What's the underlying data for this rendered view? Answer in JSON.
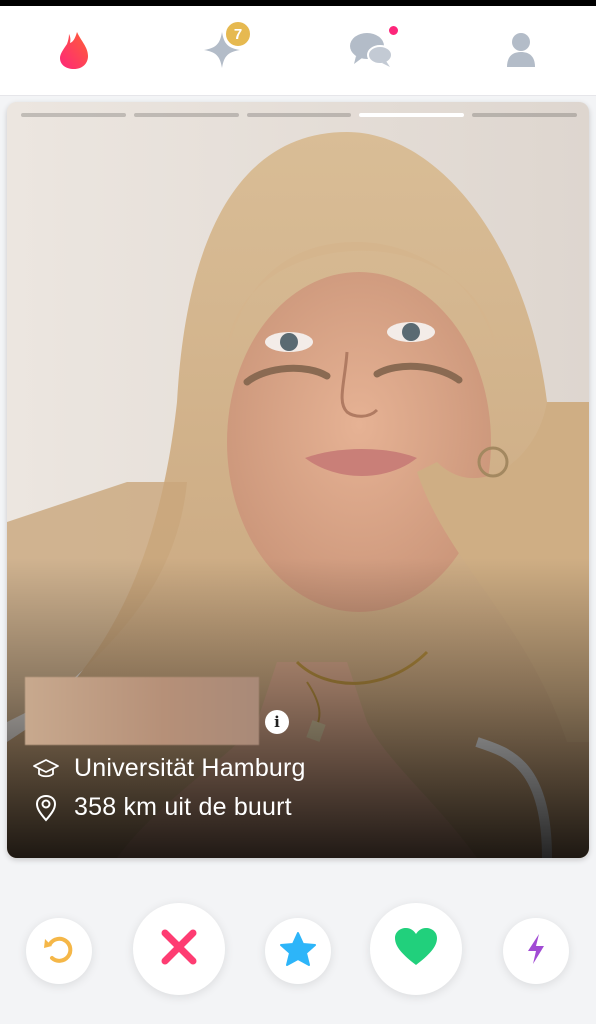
{
  "nav": {
    "items": [
      {
        "icon": "flame-icon",
        "active": true
      },
      {
        "icon": "gold-sparkle-icon",
        "badge": "7"
      },
      {
        "icon": "chat-bubbles-icon",
        "has_notification": true
      },
      {
        "icon": "profile-icon"
      }
    ]
  },
  "card": {
    "photo_count": 5,
    "active_photo_index": 3,
    "school": "Universität Hamburg",
    "distance": "358 km uit de buurt",
    "info_icon": "i"
  },
  "actions": [
    {
      "icon": "rewind-icon"
    },
    {
      "icon": "nope-x-icon"
    },
    {
      "icon": "super-like-star-icon"
    },
    {
      "icon": "like-heart-icon"
    },
    {
      "icon": "boost-bolt-icon"
    }
  ],
  "colors": {
    "brand": "#fd267a",
    "rewind": "#f5b748",
    "nope": "#fe3c72",
    "super_like": "#2db5f9",
    "like": "#21d07c",
    "boost": "#a14bd4",
    "badge": "#e6b950"
  }
}
